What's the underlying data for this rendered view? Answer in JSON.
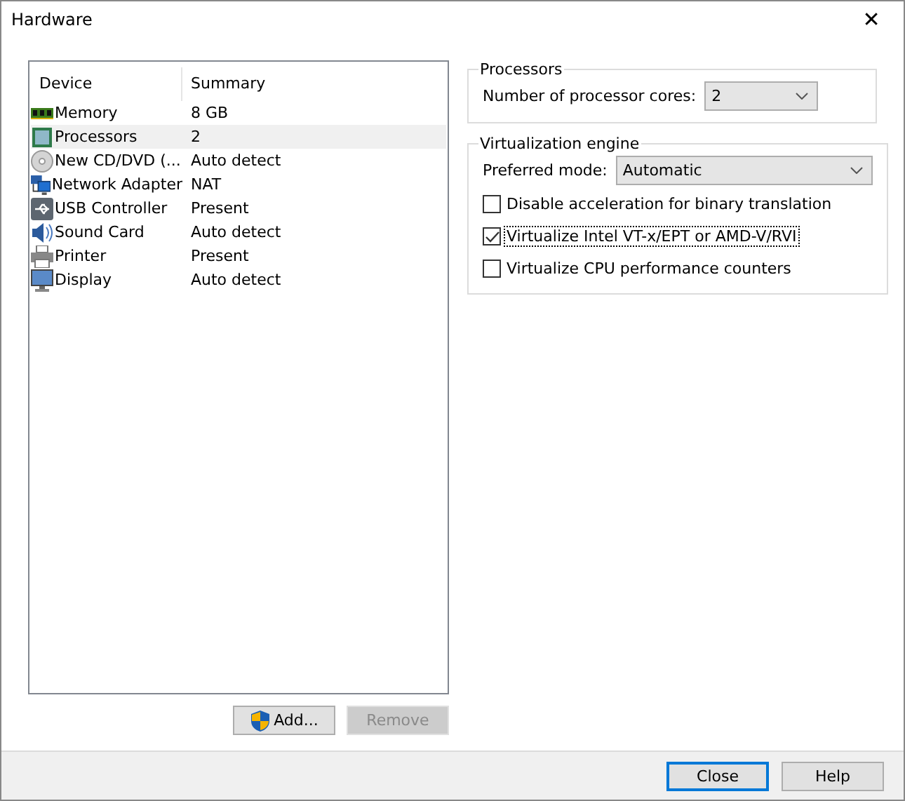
{
  "window": {
    "title": "Hardware",
    "close_glyph": "✕"
  },
  "device_list": {
    "columns": [
      "Device",
      "Summary"
    ],
    "rows": [
      {
        "device": "Memory",
        "summary": "8 GB",
        "selected": false
      },
      {
        "device": "Processors",
        "summary": "2",
        "selected": true
      },
      {
        "device": "New CD/DVD (...",
        "summary": "Auto detect",
        "selected": false
      },
      {
        "device": "Network Adapter",
        "summary": "NAT",
        "selected": false
      },
      {
        "device": "USB Controller",
        "summary": "Present",
        "selected": false
      },
      {
        "device": "Sound Card",
        "summary": "Auto detect",
        "selected": false
      },
      {
        "device": "Printer",
        "summary": "Present",
        "selected": false
      },
      {
        "device": "Display",
        "summary": "Auto detect",
        "selected": false
      }
    ]
  },
  "list_buttons": [
    {
      "label": "Add...",
      "disabled": false
    },
    {
      "label": "Remove",
      "disabled": true
    }
  ],
  "processors": {
    "title": "Processors",
    "cores_label": "Number of processor cores:",
    "cores_value": "2"
  },
  "virtualization": {
    "title": "Virtualization engine",
    "mode_label": "Preferred mode:",
    "mode_value": "Automatic",
    "options": [
      {
        "label": "Disable acceleration for binary translation",
        "checked": false,
        "focused": false
      },
      {
        "label": "Virtualize Intel VT-x/EPT or AMD-V/RVI",
        "checked": true,
        "focused": true
      },
      {
        "label": "Virtualize CPU performance counters",
        "checked": false,
        "focused": false
      }
    ]
  },
  "footer_buttons": [
    {
      "label": "Close",
      "default": true
    },
    {
      "label": "Help",
      "default": false
    }
  ]
}
